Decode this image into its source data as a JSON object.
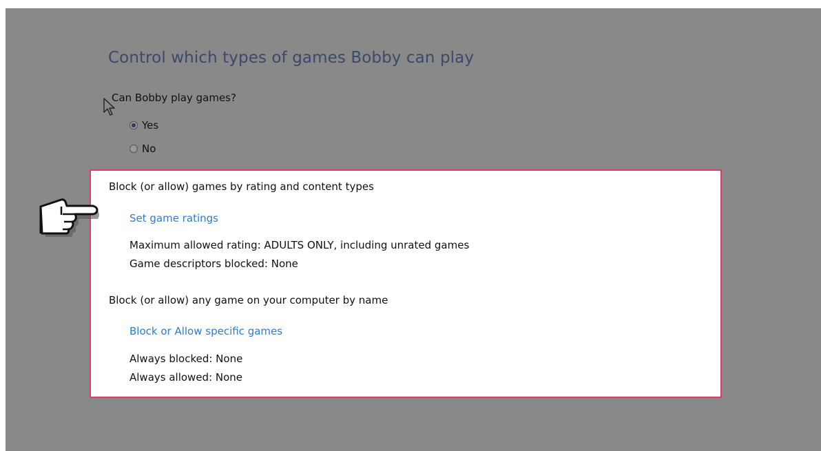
{
  "heading": "Control which types of games Bobby can play",
  "play_question": {
    "label": "Can Bobby play games?",
    "options": [
      {
        "label": "Yes",
        "selected": true
      },
      {
        "label": "No",
        "selected": false
      }
    ]
  },
  "rating_section": {
    "header": "Block (or allow) games by rating and content types",
    "link": "Set game ratings",
    "max_rating": "Maximum allowed rating:  ADULTS ONLY, including unrated games",
    "descriptors": "Game descriptors blocked:  None"
  },
  "name_section": {
    "header": "Block (or allow) any game on your computer by name",
    "link": "Block or Allow specific games",
    "always_blocked": "Always blocked:  None",
    "always_allowed": "Always allowed:  None"
  },
  "colors": {
    "highlight_border": "#e23a62",
    "link": "#2e7bcf",
    "overlay": "#898989"
  },
  "icons": [
    "arrow-cursor-icon",
    "pointing-hand-icon"
  ]
}
